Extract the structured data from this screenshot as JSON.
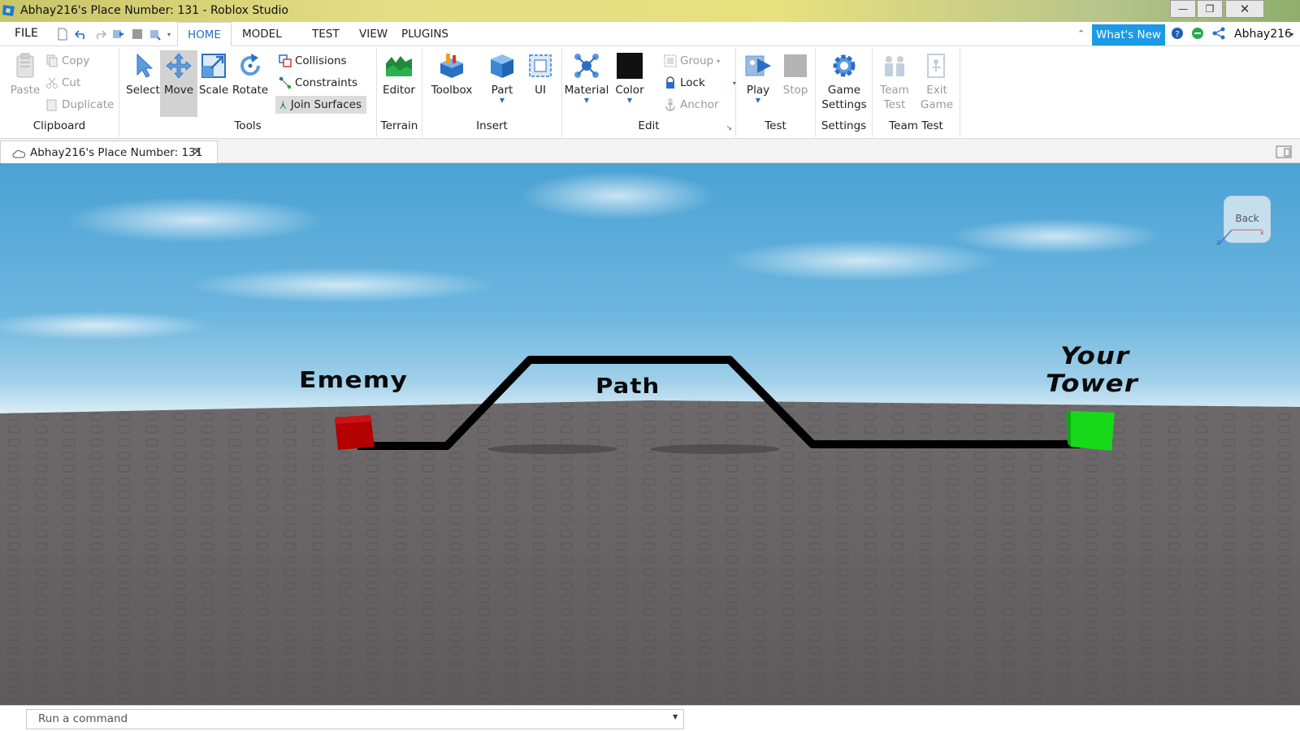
{
  "window": {
    "title": "Abhay216's Place Number: 131 - Roblox Studio",
    "minimize": "—",
    "maximize": "❐",
    "close": "✕"
  },
  "menubar": {
    "file": "FILE",
    "tabs": [
      "HOME",
      "MODEL",
      "TEST",
      "VIEW",
      "PLUGINS"
    ],
    "active_tab": "HOME",
    "whats_new": "What's New",
    "user": "Abhay216"
  },
  "ribbon": {
    "clipboard": {
      "label": "Clipboard",
      "paste": "Paste",
      "copy": "Copy",
      "cut": "Cut",
      "duplicate": "Duplicate"
    },
    "tools": {
      "label": "Tools",
      "select": "Select",
      "move": "Move",
      "scale": "Scale",
      "rotate": "Rotate",
      "collisions": "Collisions",
      "constraints": "Constraints",
      "join_surfaces": "Join Surfaces"
    },
    "terrain": {
      "label": "Terrain",
      "editor": "Editor"
    },
    "insert": {
      "label": "Insert",
      "toolbox": "Toolbox",
      "part": "Part",
      "ui": "UI"
    },
    "edit": {
      "label": "Edit",
      "material": "Material",
      "color": "Color",
      "group": "Group",
      "lock": "Lock",
      "anchor": "Anchor"
    },
    "test": {
      "label": "Test",
      "play": "Play",
      "stop": "Stop"
    },
    "settings": {
      "label": "Settings",
      "game_settings_1": "Game",
      "game_settings_2": "Settings"
    },
    "team_test": {
      "label": "Team Test",
      "team_test_1": "Team",
      "team_test_2": "Test",
      "exit_game_1": "Exit",
      "exit_game_2": "Game"
    }
  },
  "document": {
    "tab_title": "Abhay216's Place Number: 131",
    "close": "✕"
  },
  "viewport": {
    "labels": {
      "enemy": "Ememy",
      "path": "Path",
      "tower_line1": "Your",
      "tower_line2": "Tower"
    },
    "view_cube": "Back",
    "colors": {
      "enemy_block": "#b30000",
      "tower_block": "#18d81a",
      "path": "#000000",
      "baseplate": "#6a6668"
    }
  },
  "command_bar": {
    "placeholder": "Run a command"
  }
}
